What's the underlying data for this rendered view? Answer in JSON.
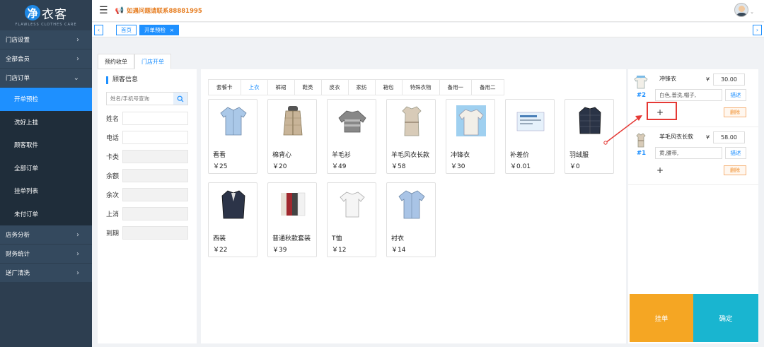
{
  "app": {
    "logo_text": "衣客",
    "logo_badge": "净",
    "logo_sub": "FLAWLESS CLOTHES CARE"
  },
  "header": {
    "notice": "如遇问题请联系88881995"
  },
  "sidebar": {
    "groups": [
      {
        "label": "门店设置"
      },
      {
        "label": "全部会员"
      },
      {
        "label": "门店订单",
        "open": true
      },
      {
        "label": "店务分析"
      },
      {
        "label": "财务统计"
      },
      {
        "label": "送厂清洗"
      }
    ],
    "sub_items": [
      {
        "label": "开单预检",
        "active": true
      },
      {
        "label": "洗好上挂"
      },
      {
        "label": "顾客取件"
      },
      {
        "label": "全部订单"
      },
      {
        "label": "挂单列表"
      },
      {
        "label": "未付订单"
      }
    ]
  },
  "tabs": [
    {
      "label": "首页"
    },
    {
      "label": "开单预检",
      "active": true,
      "close": "×"
    }
  ],
  "subtabs": [
    {
      "label": "预约收单"
    },
    {
      "label": "门店开单",
      "active": true
    }
  ],
  "customer": {
    "title": "顾客信息",
    "search_placeholder": "姓名/手机号查询",
    "fields": [
      {
        "label": "姓名"
      },
      {
        "label": "电话"
      },
      {
        "label": "卡类"
      },
      {
        "label": "余额"
      },
      {
        "label": "余次"
      },
      {
        "label": "上消"
      },
      {
        "label": "到期"
      }
    ]
  },
  "categories": [
    {
      "label": "套餐卡"
    },
    {
      "label": "上衣",
      "active": true
    },
    {
      "label": "裤裙"
    },
    {
      "label": "鞋类"
    },
    {
      "label": "皮衣"
    },
    {
      "label": "家纺"
    },
    {
      "label": "箱包"
    },
    {
      "label": "特殊衣物"
    },
    {
      "label": "备用一"
    },
    {
      "label": "备用二"
    }
  ],
  "products": [
    {
      "name": "看看",
      "price": "￥25",
      "icon": "shirt-icon",
      "color": "#aac8e8"
    },
    {
      "name": "棉背心",
      "price": "￥20",
      "icon": "vest-icon",
      "color": "#c8b498"
    },
    {
      "name": "羊毛衫",
      "price": "￥49",
      "icon": "sweater-icon",
      "color": "#888888"
    },
    {
      "name": "羊毛风衣长款",
      "price": "￥58",
      "icon": "trench-coat-icon",
      "color": "#d8cbb8"
    },
    {
      "name": "冲锋衣",
      "price": "￥30",
      "icon": "jacket-icon",
      "color": "#f2efe8"
    },
    {
      "name": "补差价",
      "price": "￥0.01",
      "icon": "ticket-icon",
      "color": "#e6f1fb"
    },
    {
      "name": "羽绒服",
      "price": "￥0",
      "icon": "down-jacket-icon",
      "color": "#2a3346"
    },
    {
      "name": "西装",
      "price": "￥22",
      "icon": "suit-icon",
      "color": "#2c3448"
    },
    {
      "name": "普通秋款套装",
      "price": "￥39",
      "icon": "outfit-set-icon",
      "color": "#a0282e"
    },
    {
      "name": "T恤",
      "price": "￥12",
      "icon": "tshirt-icon",
      "color": "#f5f5f5"
    },
    {
      "name": "衬衣",
      "price": "￥14",
      "icon": "shirt-icon",
      "color": "#a9c4e6"
    }
  ],
  "order": {
    "currency": "¥",
    "items": [
      {
        "number": "#2",
        "name": "冲锋衣",
        "price": "30.00",
        "desc": "白色,普洗,帽子,",
        "desc_btn": "描述",
        "add": "+",
        "del": "删除",
        "icon": "jacket-icon"
      },
      {
        "number": "#1",
        "name": "羊毛风衣长款",
        "price": "58.00",
        "desc": "黄,腰带,",
        "desc_btn": "描述",
        "add": "+",
        "del": "删除",
        "icon": "trench-coat-icon"
      }
    ],
    "hold_label": "挂单",
    "confirm_label": "确定"
  },
  "colors": {
    "primary": "#1e90ff",
    "sidebar": "#2d3e50",
    "hold": "#f5a623",
    "confirm": "#19b5d0",
    "highlight": "#e53935"
  }
}
